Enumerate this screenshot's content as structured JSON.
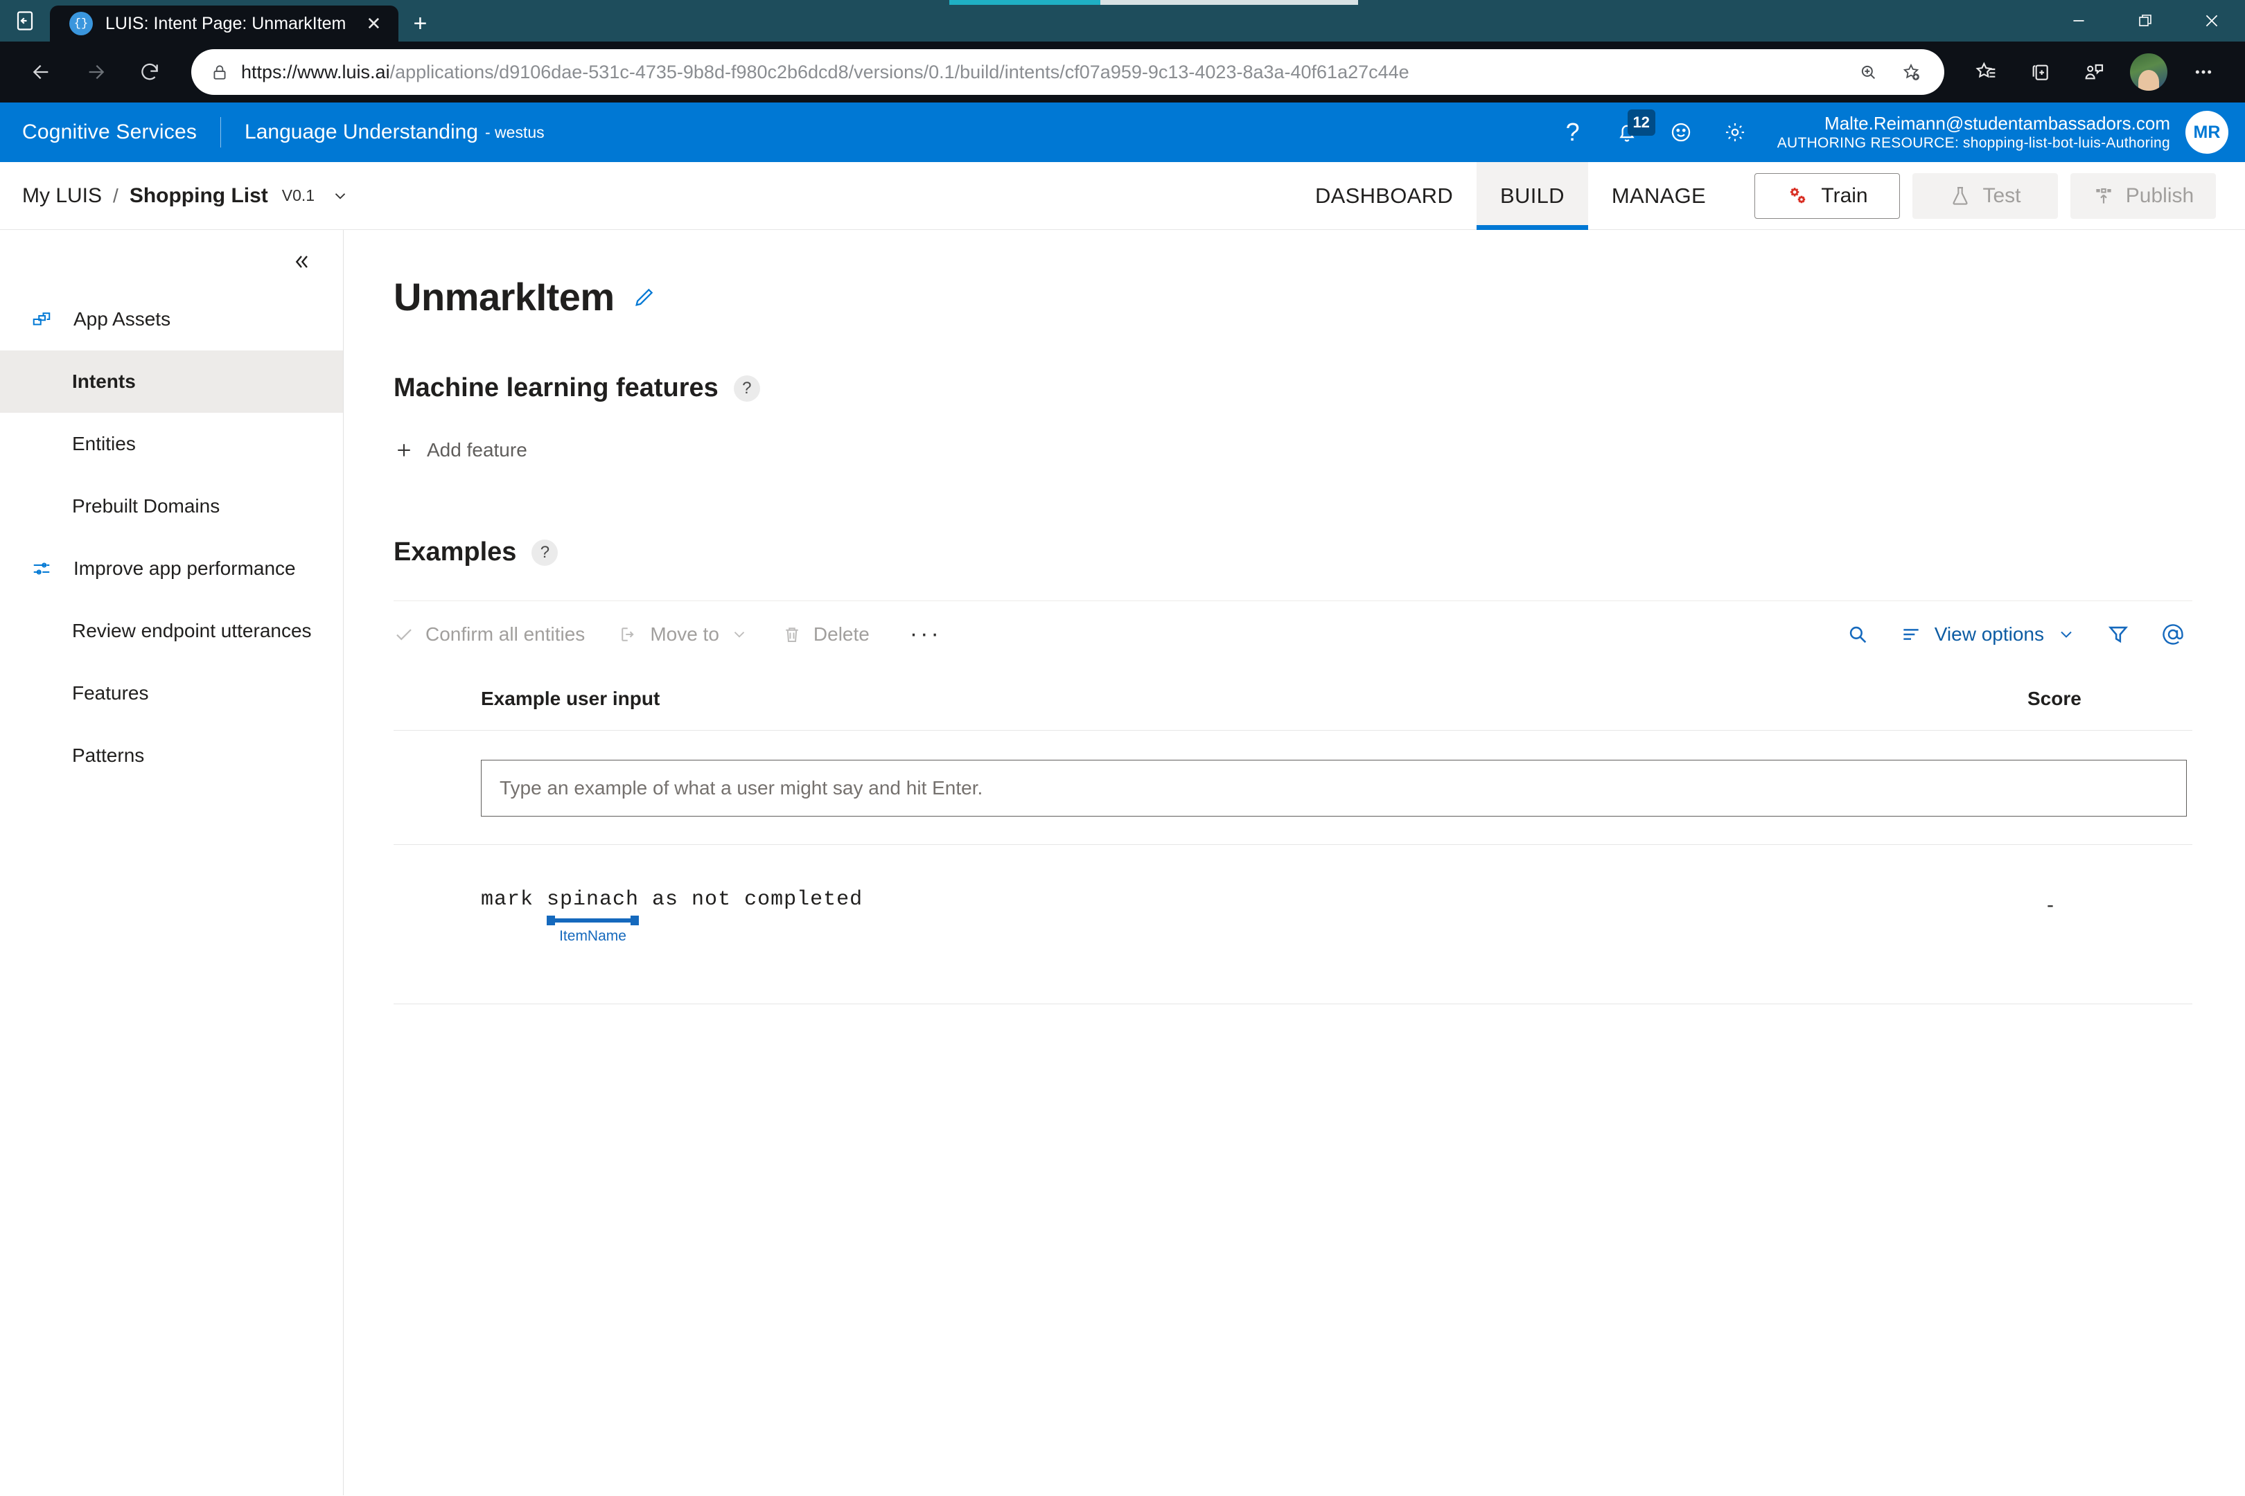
{
  "browser": {
    "tab": {
      "title": "LUIS: Intent Page: UnmarkItem",
      "favicon_glyph": "{}",
      "close_glyph": "✕"
    },
    "newtab_glyph": "+",
    "window_controls": {
      "minimize": "—",
      "maximize": "❐",
      "close": "✕"
    },
    "url": {
      "domain": "https://www.luis.ai",
      "path": "/applications/d9106dae-531c-4735-9b8d-f980c2b6dcd8/versions/0.1/build/intents/cf07a959-9c13-4023-8a3a-40f61a27c44e"
    },
    "icons": {
      "back": "back-arrow-icon",
      "forward": "forward-arrow-icon",
      "reload": "reload-icon",
      "lock": "lock-icon",
      "zoom": "zoom-icon",
      "add_favorite": "add-favorite-icon",
      "favorites": "favorites-star-icon",
      "collections": "collections-icon",
      "browser_essentials": "browser-essentials-icon",
      "profile": "profile-avatar-icon",
      "settings_more": "more-options-icon"
    }
  },
  "header": {
    "service": "Cognitive Services",
    "product": "Language Understanding",
    "region": "- westus",
    "help_glyph": "?",
    "notifications_count": "12",
    "account_email": "Malte.Reimann@studentambassadors.com",
    "authoring_label": "AUTHORING RESOURCE:",
    "authoring_resource": "shopping-list-bot-luis-Authoring",
    "avatar_initials": "MR"
  },
  "appnav": {
    "root": "My LUIS",
    "separator": "/",
    "app_name": "Shopping List",
    "version": "V0.1",
    "tabs": [
      {
        "label": "DASHBOARD",
        "active": false
      },
      {
        "label": "BUILD",
        "active": true
      },
      {
        "label": "MANAGE",
        "active": false
      }
    ],
    "actions": [
      {
        "label": "Train",
        "state": "enabled"
      },
      {
        "label": "Test",
        "state": "disabled"
      },
      {
        "label": "Publish",
        "state": "disabled"
      }
    ]
  },
  "sidebar": {
    "items": [
      {
        "label": "App Assets",
        "type": "group",
        "icon": "app-assets-icon",
        "active": false
      },
      {
        "label": "Intents",
        "type": "sub",
        "active": true
      },
      {
        "label": "Entities",
        "type": "sub",
        "active": false
      },
      {
        "label": "Prebuilt Domains",
        "type": "sub",
        "active": false
      },
      {
        "label": "Improve app performance",
        "type": "group",
        "icon": "sliders-icon",
        "active": false
      },
      {
        "label": "Review endpoint utterances",
        "type": "sub",
        "active": false
      },
      {
        "label": "Features",
        "type": "sub",
        "active": false
      },
      {
        "label": "Patterns",
        "type": "sub",
        "active": false
      }
    ]
  },
  "main": {
    "page_title": "UnmarkItem",
    "ml_features": {
      "title": "Machine learning features",
      "help_glyph": "?",
      "add_feature_label": "Add feature"
    },
    "examples": {
      "title": "Examples",
      "help_glyph": "?",
      "toolbar": {
        "confirm_all_entities": "Confirm all entities",
        "move_to": "Move to",
        "delete": "Delete",
        "more": "···",
        "view_options": "View options"
      },
      "columns": {
        "input": "Example user input",
        "score": "Score"
      },
      "new_utterance_placeholder": "Type an example of what a user might say and hit Enter.",
      "rows": [
        {
          "prefix": "mark ",
          "entity_text": "spinach",
          "entity_label": "ItemName",
          "suffix": " as not completed",
          "score": "-"
        }
      ]
    }
  },
  "colors": {
    "titlebar": "#1e4d5c",
    "browser_toolbar": "#0d1117",
    "brand_blue": "#0078d4",
    "accent_link": "#1569bd",
    "progress": "#1fb0c4",
    "train_red": "#d93025"
  }
}
